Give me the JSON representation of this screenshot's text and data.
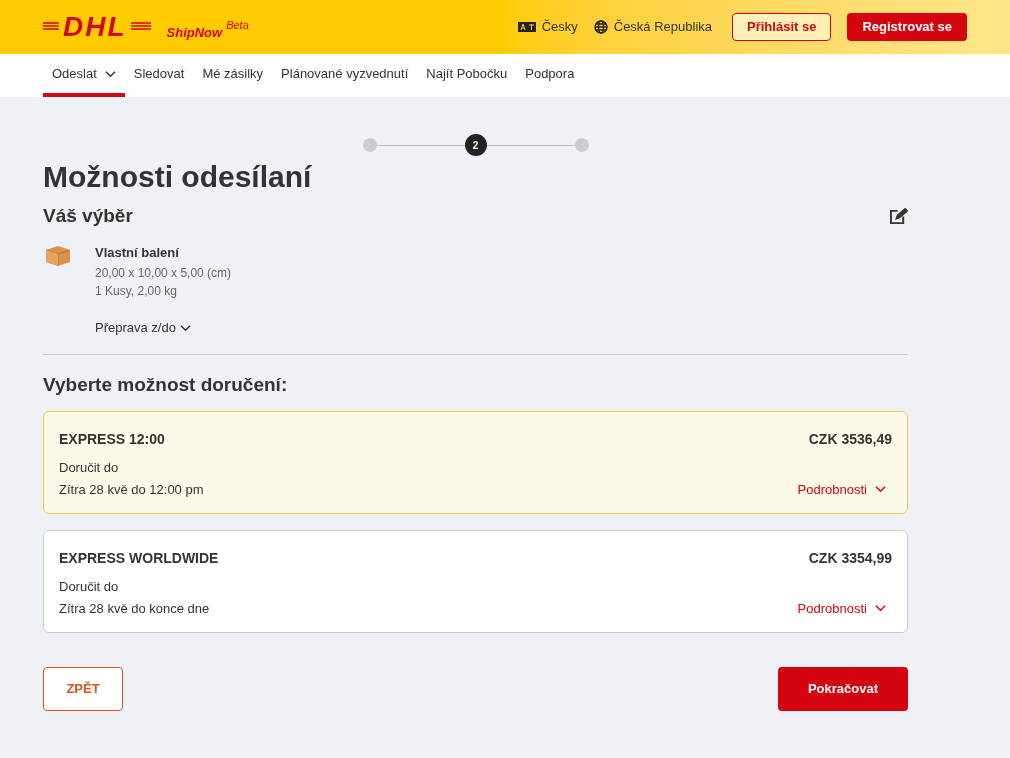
{
  "header": {
    "logo": "DHL",
    "product": "ShipNow",
    "product_badge": "Beta",
    "language": "Česky",
    "country": "Česká Republika",
    "login": "Přihlásit se",
    "register": "Registrovat se"
  },
  "nav": [
    {
      "label": "Odeslat",
      "selected": true,
      "dropdown": true
    },
    {
      "label": "Sledovat",
      "selected": false,
      "dropdown": false
    },
    {
      "label": "Mé zásilky",
      "selected": false,
      "dropdown": false
    },
    {
      "label": "Plánované vyzvednutí",
      "selected": false,
      "dropdown": false
    },
    {
      "label": "Najít Pobočku",
      "selected": false,
      "dropdown": false
    },
    {
      "label": "Podpora",
      "selected": false,
      "dropdown": false
    }
  ],
  "steps": [
    {
      "selected": false
    },
    {
      "selected": true,
      "label": "2"
    },
    {
      "selected": false
    }
  ],
  "title": "Možnosti odesílaní",
  "selection": {
    "heading": "Váš výběr",
    "package_name": "Vlastní balení",
    "dimensions": "20,00 x 10,00 x 5,00 (cm)",
    "pieces": "1 Kusy, 2,00 kg",
    "transport_toggle": "Přeprava z/do"
  },
  "delivery_heading": "Vyberte možnost doručení:",
  "options": [
    {
      "name": "EXPRESS 12:00",
      "price": "CZK 3536,49",
      "deliver_label": "Doručit do",
      "deliver_time": "Zítra 28 kvě do 12:00 pm",
      "details": "Podrobnosti",
      "selected": true
    },
    {
      "name": "EXPRESS WORLDWIDE",
      "price": "CZK 3354,99",
      "deliver_label": "Doručit do",
      "deliver_time": "Zítra 28 kvě do konce dne",
      "details": "Podrobnosti",
      "selected": false
    }
  ],
  "back_button": "ZPĚT",
  "continue_button": "Pokračovat"
}
